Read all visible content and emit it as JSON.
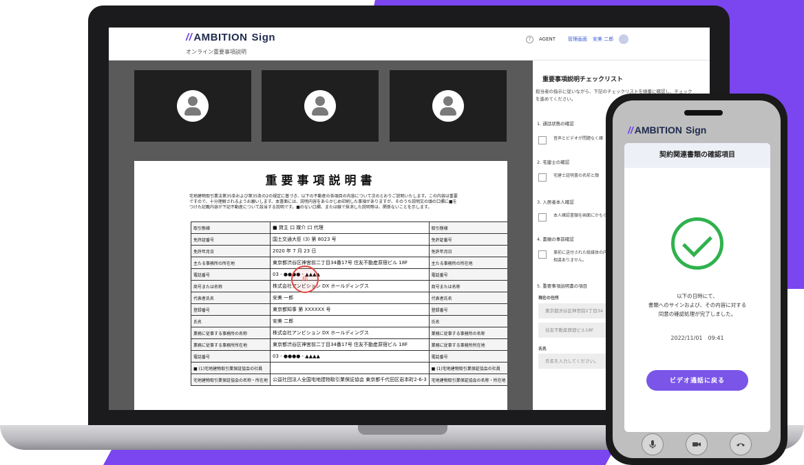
{
  "brand": {
    "logo_prefix": "//",
    "logo_name": "AMBITION",
    "logo_sign": "Sign",
    "accent": "#7b45f0"
  },
  "laptop": {
    "header": {
      "subtitle": "オンライン重要事項説明",
      "agent_label": "AGENT",
      "admin_link": "管理画面",
      "user_name": "安美 二郎"
    },
    "document": {
      "title": "重要事項説明書",
      "paragraph": "宅地建物取引業法第35条および第35条の2の規定に基づき、以下の不動産の各項目の内容について次のとおりご説明いたします。この内容は重要ですので、十分理解されるようお願いします。本書面には、説明内容をあらかじめ印刷した事項がありますが、そのうち説明又の頭の口欄に■をつけた記載内容が下記不動産について該当する説明です。■のない口欄、または線で抹消した説明等は、関係ないことを示します。",
      "seal_text": "印",
      "rows": [
        [
          "取引態様",
          "■ 貸主 口 媒介 口 代理",
          "取引態様",
          "口 貸主 ■ 媒介 口 代理"
        ],
        [
          "免許証番号",
          "国土交通大臣 (3) 第 8023 号",
          "免許証番号",
          "国土交通大臣 (1) 第 9XXX 号"
        ],
        [
          "免許年月日",
          "2020 年 7 月 23 日",
          "免許年月日",
          "2020 年 2 月 28 日"
        ],
        [
          "主たる事務所の所在地",
          "東京都渋谷区神宮前二丁目34番17号 住友不動産原宿ビル 18F",
          "主たる事務所の所在地",
          "東京都渋谷区神宮前二丁目34番17号 住友不動産原宿ビル 18F"
        ],
        [
          "電話番号",
          "03 - ●●●● - ▲▲▲▲",
          "電話番号",
          "03 - ■■■■ - ▲▲▲▲"
        ],
        [
          "商号または名称",
          "株式会社アンビション DX ホールディングス",
          "商号または名称",
          "仲介会社A"
        ],
        [
          "代表者氏名",
          "安美 一郎",
          "代表者氏名",
          "仲介 一郎"
        ],
        [
          "登録番号",
          "東京都知事 第 XXXXXX 号",
          "登録番号",
          "東京都知事 第 XXXXXX 号"
        ],
        [
          "氏名",
          "安美 二郎",
          "氏名",
          "仲介 二郎"
        ],
        [
          "業務に従事する事務所の名称",
          "株式会社アンビション DX ホールディングス",
          "業務に従事する事務所の名称",
          "仲介会社A"
        ],
        [
          "業務に従事する事務所所在地",
          "東京都渋谷区神宮前二丁目34番17号 住友不動産原宿ビル 18F",
          "業務に従事する事務所所在地",
          "東京都渋谷区神宮前二丁目34番17号 住友不動産原宿ビル 18F"
        ],
        [
          "電話番号",
          "03 - ●●●● - ▲▲▲▲",
          "電話番号",
          "03 - ■■■■ - ▲▲▲▲"
        ],
        [
          "■ (1)宅地建物取引業保証協会の社員",
          "",
          "■ (1)宅地建物取引業保証協会の社員",
          ""
        ],
        [
          "宅地建物取引業保証協会の名称・所在地",
          "公益社団法人全国宅地建物取引業保証協会 東京都千代田区岩本町2-6-3",
          "宅地建物取引業保証協会の名称・所在地",
          "公益社団法人全国宅地建物取引業保証協会 東京都千代田区岩本町2-6-3"
        ]
      ]
    },
    "checklist": {
      "title": "重要事項説明チェックリスト",
      "description": "担当者の指示に従いながら、下記のチェックリストを順番に確認し、チェックを進めてください。",
      "sections": [
        {
          "heading": "1. 通話状態の確認",
          "items": [
            "音声とビデオが問題なく確"
          ]
        },
        {
          "heading": "2. 宅建士の確認",
          "items": [
            "宅建士証明書の名前と顔"
          ]
        },
        {
          "heading": "3. 入居者本人確認",
          "items": [
            "本人確認書類を画面にかもらう。"
          ]
        },
        {
          "heading": "4. 書類の事前確認",
          "items": [
            "事前に送付された紙媒体の内容に相違ありません。"
          ]
        }
      ],
      "section5": {
        "heading": "5. 重要事項説明書の項目",
        "address_label": "現在の住所",
        "address_value": "東京都渋谷区神宮前2丁目34",
        "address_value2": "住友不動産原宿ビル18F",
        "name_label": "氏名",
        "name_placeholder": "氏名を入力してください。"
      }
    }
  },
  "phone": {
    "card_title": "契約関連書類の確認項目",
    "message_line1": "以下の日時にて、",
    "message_line2": "書類へのサインおよび、その内容に対する",
    "message_line3": "同意の確認処理が完了しました。",
    "datetime": "2022/11/01　09:41",
    "button_label": "ビデオ通話に戻る",
    "controls": [
      "mic-icon",
      "camera-icon",
      "hangup-icon"
    ]
  }
}
